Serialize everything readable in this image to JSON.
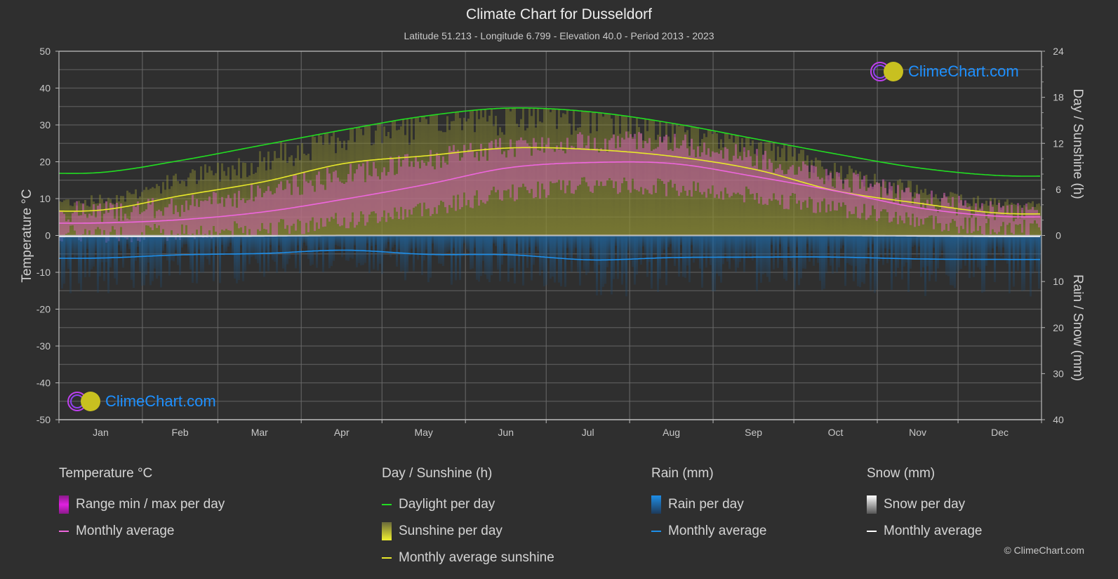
{
  "header": {
    "title": "Climate Chart for Dusseldorf",
    "subtitle": "Latitude 51.213 - Longitude 6.799 - Elevation 40.0 - Period 2013 - 2023"
  },
  "logo_text": "ClimeChart.com",
  "copyright": "© ClimeChart.com",
  "chart_data": {
    "type": "line",
    "title": "Climate Chart for Dusseldorf",
    "categories": [
      "Jan",
      "Feb",
      "Mar",
      "Apr",
      "May",
      "Jun",
      "Jul",
      "Aug",
      "Sep",
      "Oct",
      "Nov",
      "Dec"
    ],
    "axes": {
      "left": {
        "label": "Temperature °C",
        "range": [
          -50,
          50
        ],
        "ticks": [
          "50",
          "40",
          "30",
          "20",
          "10",
          "0",
          "-10",
          "-20",
          "-30",
          "-40",
          "-50"
        ]
      },
      "right_top": {
        "label": "Day / Sunshine (h)",
        "range": [
          0,
          24
        ],
        "ticks": [
          "24",
          "18",
          "12",
          "6",
          "0"
        ]
      },
      "right_bottom": {
        "label": "Rain / Snow (mm)",
        "range": [
          0,
          40
        ],
        "ticks": [
          "10",
          "20",
          "30",
          "40"
        ]
      }
    },
    "grid": true,
    "series": [
      {
        "name": "Daylight per day",
        "unit": "h",
        "color": "#22dd22",
        "values": [
          8.2,
          9.8,
          11.8,
          13.8,
          15.6,
          16.6,
          16.1,
          14.6,
          12.6,
          10.6,
          8.8,
          7.8
        ]
      },
      {
        "name": "Monthly average sunshine",
        "unit": "h",
        "color": "#e8e82a",
        "values": [
          3.3,
          5.2,
          7.0,
          9.4,
          10.4,
          11.4,
          11.2,
          10.3,
          8.6,
          5.8,
          4.2,
          2.9
        ]
      },
      {
        "name": "Temperature monthly average",
        "unit": "°C",
        "color": "#ee66dd",
        "values": [
          3.4,
          4.3,
          6.4,
          9.9,
          13.9,
          18.4,
          19.8,
          19.5,
          16.0,
          12.0,
          7.5,
          5.2
        ]
      },
      {
        "name": "Rain monthly average",
        "unit": "mm",
        "color": "#1e8ee8",
        "values": [
          4.9,
          4.2,
          3.9,
          3.2,
          4.1,
          4.2,
          5.3,
          4.8,
          4.7,
          4.7,
          5.1,
          5.2
        ]
      },
      {
        "name": "Snow monthly average",
        "unit": "mm",
        "color": "#ffffff",
        "values": [
          0.2,
          0.2,
          0.1,
          0,
          0,
          0,
          0,
          0,
          0,
          0,
          0.1,
          0.2
        ]
      }
    ],
    "ranges": {
      "temp_max_avg": [
        6.5,
        8.0,
        12.0,
        16.5,
        20.5,
        24.0,
        25.5,
        25.0,
        21.0,
        15.5,
        10.0,
        7.0
      ],
      "temp_min_avg": [
        0.5,
        1.0,
        2.0,
        4.0,
        7.5,
        11.5,
        13.5,
        13.0,
        10.5,
        7.5,
        4.0,
        2.0
      ]
    }
  },
  "legend": {
    "groups": [
      {
        "title": "Temperature °C",
        "items": [
          {
            "label": "Range min / max per day",
            "kind": "swatch",
            "color": "#e020e0"
          },
          {
            "label": "Monthly average",
            "kind": "line",
            "color": "#ee66dd"
          }
        ]
      },
      {
        "title": "Day / Sunshine (h)",
        "items": [
          {
            "label": "Daylight per day",
            "kind": "line",
            "color": "#22dd22"
          },
          {
            "label": "Sunshine per day",
            "kind": "swatch",
            "color": "#e8e82a"
          },
          {
            "label": "Monthly average sunshine",
            "kind": "line",
            "color": "#e8e82a"
          }
        ]
      },
      {
        "title": "Rain (mm)",
        "items": [
          {
            "label": "Rain per day",
            "kind": "swatch",
            "color": "#1e8ee8"
          },
          {
            "label": "Monthly average",
            "kind": "line",
            "color": "#1e8ee8"
          }
        ]
      },
      {
        "title": "Snow (mm)",
        "items": [
          {
            "label": "Snow per day",
            "kind": "swatch",
            "color": "#dddddd"
          },
          {
            "label": "Monthly average",
            "kind": "line",
            "color": "#ffffff"
          }
        ]
      }
    ]
  }
}
